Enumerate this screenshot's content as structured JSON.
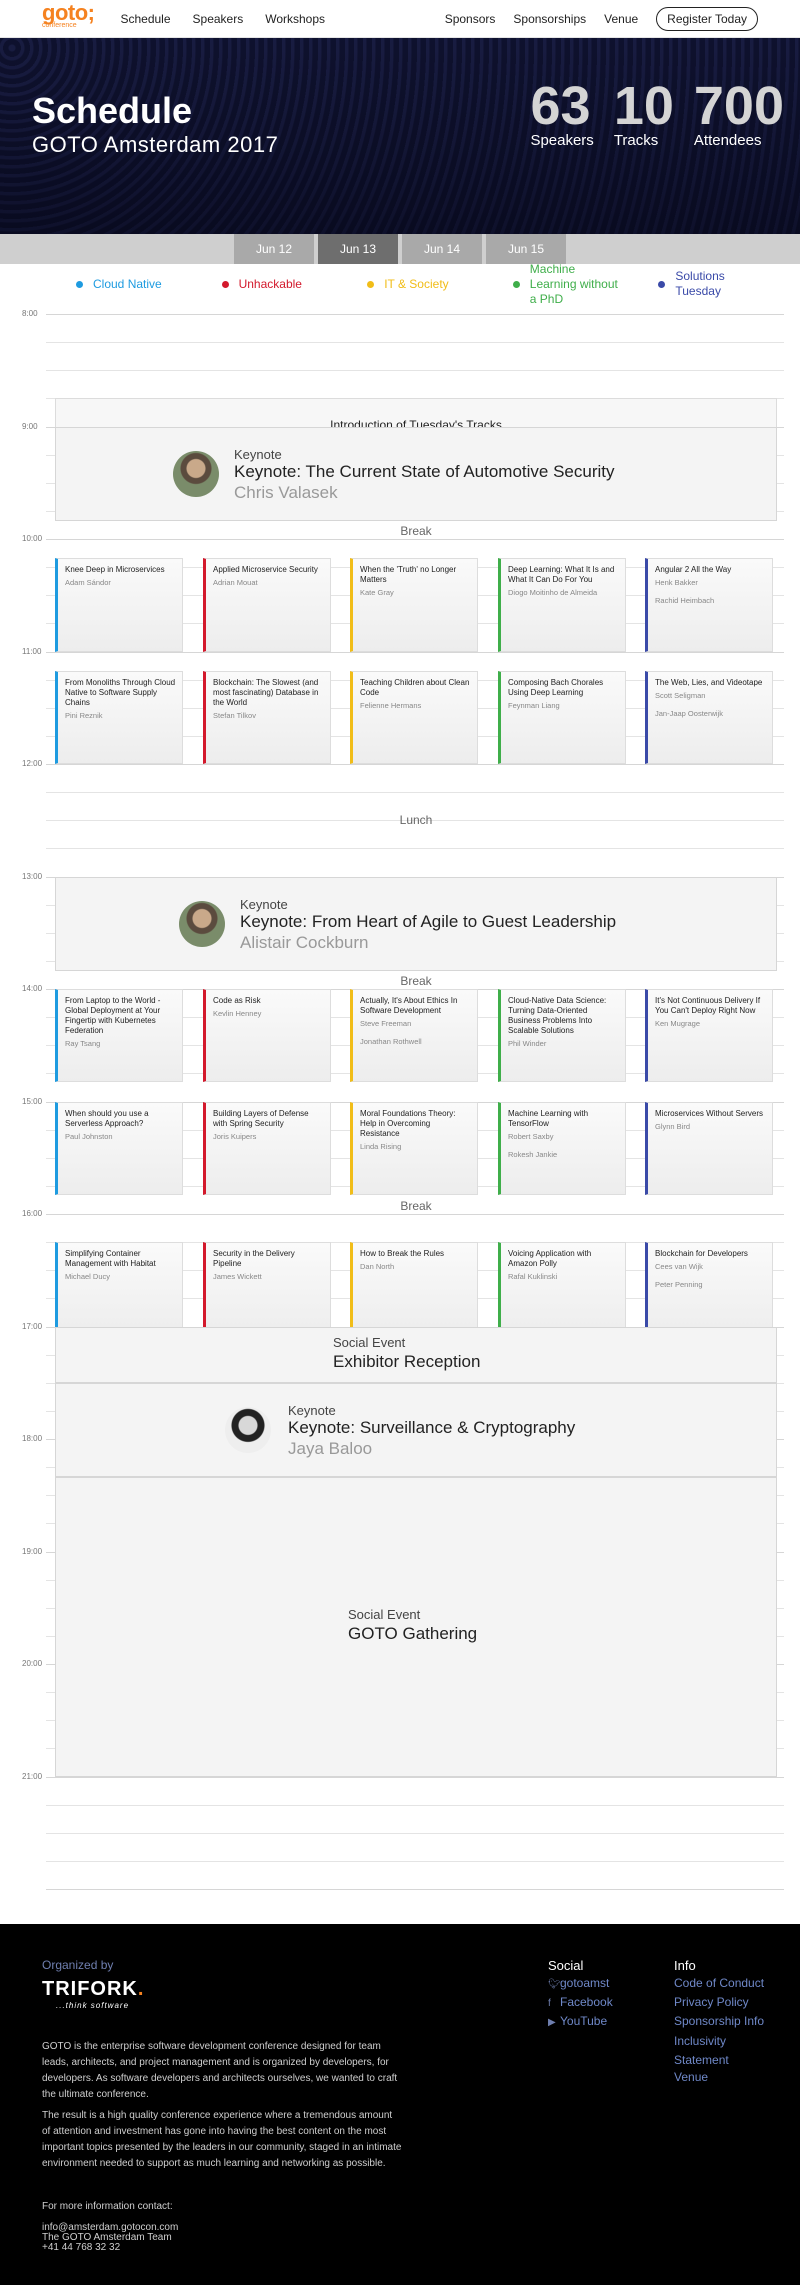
{
  "nav": {
    "logo": "goto;",
    "logo_sub": "conference",
    "left": [
      "Schedule",
      "Speakers",
      "Workshops"
    ],
    "right": [
      "Sponsors",
      "Sponsorships",
      "Venue"
    ],
    "register": "Register Today"
  },
  "hero": {
    "title": "Schedule",
    "subtitle": "GOTO Amsterdam 2017",
    "stats": [
      {
        "num": "63",
        "label": "Speakers"
      },
      {
        "num": "10",
        "label": "Tracks"
      },
      {
        "num": "700",
        "label": "Attendees"
      }
    ]
  },
  "days": [
    "Jun 12",
    "Jun 13",
    "Jun 14",
    "Jun 15"
  ],
  "active_day": 1,
  "tracks": [
    {
      "name": "Cloud Native",
      "color": "#1e9be0"
    },
    {
      "name": "Unhackable",
      "color": "#d3192c"
    },
    {
      "name": "IT & Society",
      "color": "#f1bd18"
    },
    {
      "name": "Machine Learning without a PhD",
      "color": "#3fae4a"
    },
    {
      "name": "Solutions Tuesday",
      "color": "#3a4aa8"
    }
  ],
  "hours": [
    "8:00",
    "9:00",
    "10:00",
    "11:00",
    "12:00",
    "13:00",
    "14:00",
    "15:00",
    "16:00",
    "17:00",
    "18:00",
    "19:00",
    "20:00",
    "21:00"
  ],
  "schedule": {
    "intro": "Introduction of Tuesday's Tracks",
    "keynote1": {
      "kicker": "Keynote",
      "title": "Keynote: The Current State of Automotive Security",
      "speaker": "Chris Valasek"
    },
    "break_label": "Break",
    "lunch": "Lunch",
    "keynote2": {
      "kicker": "Keynote",
      "title": "Keynote: From Heart of Agile to Guest Leadership",
      "speaker": "Alistair Cockburn"
    },
    "social1": {
      "kicker": "Social Event",
      "title": "Exhibitor Reception"
    },
    "keynote3": {
      "kicker": "Keynote",
      "title": "Keynote: Surveillance & Cryptography",
      "speaker": "Jaya Baloo"
    },
    "social2": {
      "kicker": "Social Event",
      "title": "GOTO Gathering"
    },
    "rows": [
      [
        {
          "title": "Knee Deep in Microservices",
          "speakers": [
            "Adam Sándor"
          ]
        },
        {
          "title": "Applied Microservice Security",
          "speakers": [
            "Adrian Mouat"
          ]
        },
        {
          "title": "When the 'Truth' no Longer Matters",
          "speakers": [
            "Kate Gray"
          ]
        },
        {
          "title": "Deep Learning: What It Is and What It Can Do For You",
          "speakers": [
            "Diogo Moitinho de Almeida"
          ]
        },
        {
          "title": "Angular 2 All the Way",
          "speakers": [
            "Henk Bakker",
            "Rachid Heimbach"
          ]
        }
      ],
      [
        {
          "title": "From Monoliths Through Cloud Native to Software Supply Chains",
          "speakers": [
            "Pini Reznik"
          ]
        },
        {
          "title": "Blockchain: The Slowest (and most fascinating) Database in the World",
          "speakers": [
            "Stefan Tilkov"
          ]
        },
        {
          "title": "Teaching Children about Clean Code",
          "speakers": [
            "Felienne Hermans"
          ]
        },
        {
          "title": "Composing Bach Chorales Using Deep Learning",
          "speakers": [
            "Feynman Liang"
          ]
        },
        {
          "title": "The Web, Lies, and Videotape",
          "speakers": [
            "Scott Seligman",
            "Jan-Jaap Oosterwijk"
          ]
        }
      ],
      [
        {
          "title": "From Laptop to the World - Global Deployment at Your Fingertip with Kubernetes Federation",
          "speakers": [
            "Ray Tsang"
          ]
        },
        {
          "title": "Code as Risk",
          "speakers": [
            "Kevlin Henney"
          ]
        },
        {
          "title": "Actually, It's About Ethics In Software Development",
          "speakers": [
            "Steve Freeman",
            "Jonathan Rothwell"
          ]
        },
        {
          "title": "Cloud-Native Data Science: Turning Data-Oriented Business Problems Into Scalable Solutions",
          "speakers": [
            "Phil Winder"
          ]
        },
        {
          "title": "It's Not Continuous Delivery If You Can't Deploy Right Now",
          "speakers": [
            "Ken Mugrage"
          ]
        }
      ],
      [
        {
          "title": "When should you use a Serverless Approach?",
          "speakers": [
            "Paul Johnston"
          ]
        },
        {
          "title": "Building Layers of Defense with Spring Security",
          "speakers": [
            "Joris Kuipers"
          ]
        },
        {
          "title": "Moral Foundations Theory: Help in Overcoming Resistance",
          "speakers": [
            "Linda Rising"
          ]
        },
        {
          "title": "Machine Learning with TensorFlow",
          "speakers": [
            "Robert Saxby",
            "Rokesh Jankie"
          ]
        },
        {
          "title": "Microservices Without Servers",
          "speakers": [
            "Glynn Bird"
          ]
        }
      ],
      [
        {
          "title": "Simplifying Container Management with Habitat",
          "speakers": [
            "Michael Ducy"
          ]
        },
        {
          "title": "Security in the Delivery Pipeline",
          "speakers": [
            "James Wickett"
          ]
        },
        {
          "title": "How to Break the Rules",
          "speakers": [
            "Dan North"
          ]
        },
        {
          "title": "Voicing Application with Amazon Polly",
          "speakers": [
            "Rafal Kuklinski"
          ]
        },
        {
          "title": "Blockchain for Developers",
          "speakers": [
            "Cees van Wijk",
            "Peter Penning"
          ]
        }
      ]
    ]
  },
  "footer": {
    "organized_by": "Organized by",
    "brand": "TRIFORK",
    "brand_dot": ".",
    "tagline": "...think software",
    "para1": "GOTO is the enterprise software development conference designed for team leads, architects, and project management and is organized by developers, for developers. As software developers and architects ourselves, we wanted to craft the ultimate conference.",
    "para2": "The result is a high quality conference experience where a tremendous amount of attention and investment has gone into having the best content on the most important topics presented by the leaders in our community, staged in an intimate environment needed to support as much learning and networking as possible.",
    "contact_heading": "For more information contact:",
    "email": "info@amsterdam.gotocon.com",
    "team": "The GOTO Amsterdam Team",
    "phone": "+41 44 768 32 32",
    "social_heading": "Social",
    "social": [
      "gotoamst",
      "Facebook",
      "YouTube"
    ],
    "info_heading": "Info",
    "info": [
      "Code of Conduct",
      "Privacy Policy",
      "Sponsorship Info",
      "Inclusivity Statement",
      "Venue"
    ]
  }
}
